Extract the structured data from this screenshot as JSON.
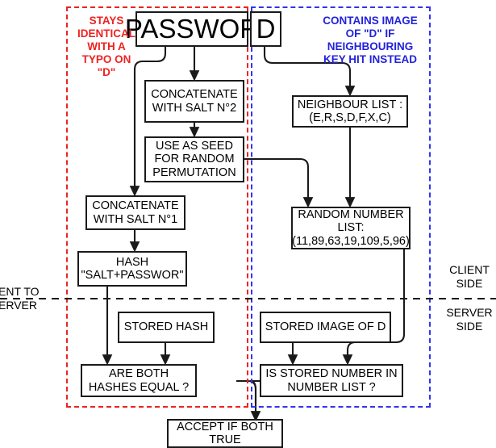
{
  "diagram": {
    "title": "Password typo-tolerance authentication flow",
    "colors": {
      "client_zone": "#ee2222",
      "server_zone": "#3333ee",
      "node_border": "#1a1a1a",
      "line": "#333333",
      "text": "#000000"
    },
    "notes": [
      {
        "name": "note-stays-identical",
        "text": "STAYS\nIDENTICAL\nWITH A\nTYPO ON\n\"D\"",
        "color": "red"
      },
      {
        "name": "note-contains-image",
        "text": "CONTAINS IMAGE\nOF \"D\" IF\nNEIGHBOURING\nKEY HIT INSTEAD",
        "color": "blue"
      }
    ],
    "side_labels": [
      {
        "name": "sent-to-server-label",
        "text": "ENT TO\nERVER"
      },
      {
        "name": "client-side-label",
        "text": "CLIENT\nSIDE"
      },
      {
        "name": "server-side-label",
        "text": "SERVER\nSIDE"
      }
    ],
    "nodes": [
      {
        "name": "password-prefix-box",
        "text": "PASSWOR"
      },
      {
        "name": "password-last-char-box",
        "text": "D"
      },
      {
        "name": "concatenate-salt2-box",
        "text": "CONCATENATE\nWITH SALT N°2"
      },
      {
        "name": "use-as-seed-box",
        "text": "USE AS SEED\nFOR RANDOM\nPERMUTATION"
      },
      {
        "name": "neighbour-list-box",
        "text": "NEIGHBOUR LIST :\n(E,R,S,D,F,X,C)"
      },
      {
        "name": "concatenate-salt1-box",
        "text": "CONCATENATE\nWITH SALT N°1"
      },
      {
        "name": "random-number-list-box",
        "text": "RANDOM NUMBER\nLIST:\n(11,89,63,19,109,5,96)"
      },
      {
        "name": "hash-box",
        "text": "HASH\n\"SALT+PASSWOR\""
      },
      {
        "name": "stored-hash-box",
        "text": "STORED HASH"
      },
      {
        "name": "stored-image-of-d-box",
        "text": "STORED IMAGE OF D"
      },
      {
        "name": "are-both-hashes-equal-box",
        "text": "ARE BOTH\nHASHES EQUAL ?"
      },
      {
        "name": "is-stored-number-in-list-box",
        "text": "IS STORED NUMBER IN\nNUMBER LIST ?"
      },
      {
        "name": "accept-if-both-true-box",
        "text": "ACCEPT IF BOTH\nTRUE"
      }
    ]
  }
}
